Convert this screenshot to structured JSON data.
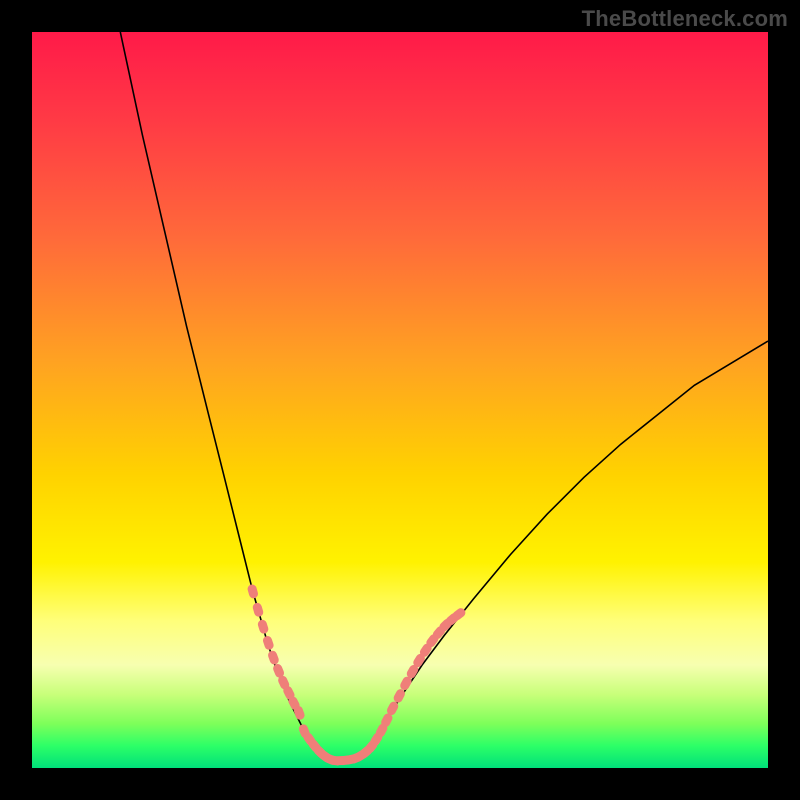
{
  "watermark": "TheBottleneck.com",
  "colors": {
    "gradient_top": "#ff1a49",
    "gradient_mid": "#fff200",
    "gradient_bottom": "#00e07a",
    "curve": "#000000",
    "dots": "#ef7f79",
    "frame": "#000000"
  },
  "chart_data": {
    "type": "line",
    "title": "",
    "xlabel": "",
    "ylabel": "",
    "xlim": [
      0,
      100
    ],
    "ylim": [
      0,
      100
    ],
    "note": "Asymmetric V-shaped bottleneck curve. Minimum ~0 at x≈39; left branch reaches y=100 near x≈12; right branch reaches y≈58 at x=100. Salmon dots mark densely sampled points near the valley on both branches and along the flat bottom.",
    "series": [
      {
        "name": "curve",
        "x": [
          12,
          15,
          18,
          21,
          24,
          26,
          28,
          30,
          31,
          32,
          33,
          34,
          35,
          36,
          37,
          38,
          39,
          40,
          41,
          42,
          43,
          44,
          45,
          46,
          47,
          48,
          50,
          53,
          56,
          60,
          65,
          70,
          75,
          80,
          85,
          90,
          95,
          100
        ],
        "y": [
          100,
          86,
          73,
          60,
          48,
          40,
          32,
          24,
          20.5,
          17,
          14,
          11.5,
          9,
          7,
          5,
          3,
          1.8,
          1.2,
          1.0,
          1.0,
          1.1,
          1.4,
          2.0,
          3.0,
          4.5,
          6.3,
          9.5,
          14,
          18,
          23,
          29,
          34.5,
          39.5,
          44,
          48,
          52,
          55,
          58
        ]
      }
    ],
    "highlight_points": {
      "name": "salmon-dots",
      "x": [
        30,
        30.7,
        31.4,
        32.1,
        32.8,
        33.5,
        34.2,
        34.9,
        35.6,
        36.3,
        37,
        37.7,
        38.4,
        39.1,
        39.8,
        40.5,
        41.2,
        41.9,
        42.6,
        43.3,
        44,
        44.7,
        45.4,
        46.1,
        46.8,
        47.5,
        48.2,
        49,
        49.9,
        50.8,
        51.7,
        52.6,
        53.5,
        54.4,
        55.3,
        56.2,
        57.1,
        58
      ],
      "y": [
        24,
        21.5,
        19.2,
        17,
        15,
        13.2,
        11.6,
        10.2,
        8.8,
        7.5,
        5,
        3.9,
        3,
        2.2,
        1.6,
        1.2,
        1.0,
        1.0,
        1.05,
        1.15,
        1.35,
        1.7,
        2.2,
        2.9,
        3.9,
        5.1,
        6.5,
        8.1,
        9.8,
        11.5,
        13.1,
        14.6,
        16,
        17.3,
        18.4,
        19.4,
        20.2,
        20.9
      ]
    }
  }
}
